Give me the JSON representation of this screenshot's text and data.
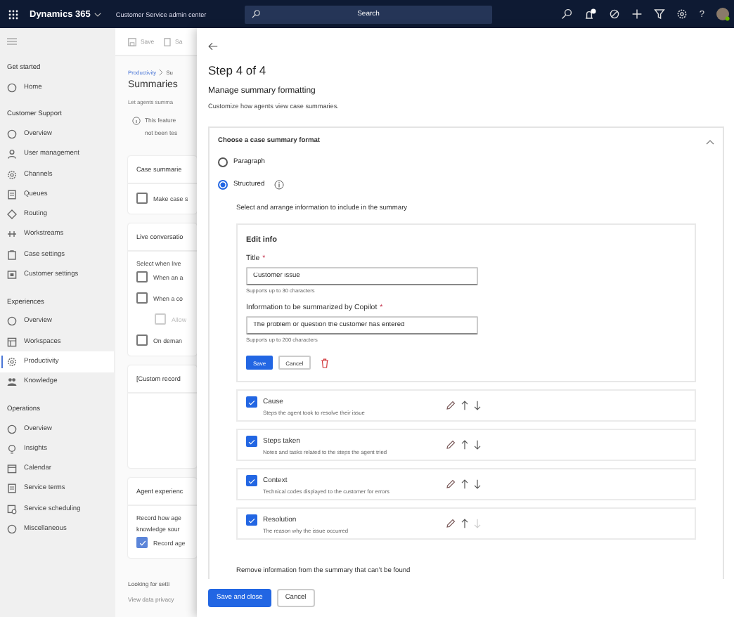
{
  "top_bar": {
    "app_name": "Dynamics 365",
    "area": "Customer Service admin center",
    "search": {
      "placeholder": "Search"
    },
    "help_label": "?"
  },
  "nav": {
    "groups": [
      {
        "label": "Get started",
        "items": [
          {
            "label": "Home",
            "selected": false
          }
        ]
      },
      {
        "label": "Customer Support",
        "items": [
          {
            "label": "Overview",
            "selected": false
          },
          {
            "label": "User management",
            "selected": false
          },
          {
            "label": "Channels",
            "selected": false
          },
          {
            "label": "Queues",
            "selected": false
          },
          {
            "label": "Routing",
            "selected": false
          },
          {
            "label": "Workstreams",
            "selected": false
          },
          {
            "label": "Case settings",
            "selected": false
          },
          {
            "label": "Customer settings",
            "selected": false
          }
        ]
      },
      {
        "label": "Experiences",
        "items": [
          {
            "label": "Overview",
            "selected": false
          },
          {
            "label": "Workspaces",
            "selected": false
          },
          {
            "label": "Productivity",
            "selected": true
          },
          {
            "label": "Knowledge",
            "selected": false
          }
        ]
      },
      {
        "label": "Operations",
        "items": [
          {
            "label": "Overview",
            "selected": false
          },
          {
            "label": "Insights",
            "selected": false
          },
          {
            "label": "Calendar",
            "selected": false
          },
          {
            "label": "Service terms",
            "selected": false
          },
          {
            "label": "Service scheduling",
            "selected": false
          },
          {
            "label": "Miscellaneous",
            "selected": false
          }
        ]
      }
    ]
  },
  "background_page": {
    "toolbar": [
      "Save",
      "Sa"
    ],
    "breadcrumb": [
      "Productivity",
      "Su"
    ],
    "title": "Summaries",
    "subtitle": "Let agents summa",
    "notice": [
      "This feature",
      "not been tes"
    ],
    "cards": [
      {
        "title": "Case summarie",
        "rows": [
          {
            "kind": "checkbox",
            "label": "Make case s",
            "checked": false,
            "disabled": false
          }
        ]
      },
      {
        "title": "Live conversatio",
        "rows": [
          {
            "kind": "text",
            "label": "Select when live"
          },
          {
            "kind": "checkbox",
            "label": "When an a",
            "checked": false,
            "disabled": false
          },
          {
            "kind": "checkbox",
            "label": "When a co",
            "checked": false,
            "disabled": false,
            "children": [
              {
                "kind": "checkbox",
                "label": "Allow",
                "checked": false,
                "disabled": true
              }
            ]
          },
          {
            "kind": "checkbox",
            "label": "On deman",
            "checked": false,
            "disabled": false
          }
        ]
      },
      {
        "title": "[Custom record"
      },
      {
        "title": "Agent experienc",
        "rows": [
          {
            "kind": "text",
            "label": "Record how age"
          },
          {
            "kind": "text",
            "label": "knowledge sour"
          },
          {
            "kind": "checkbox",
            "label": "Record age",
            "checked": true,
            "disabled": false
          }
        ]
      }
    ],
    "footer": [
      "Looking for setti",
      "View data privacy"
    ]
  },
  "panel": {
    "step": "Step 4 of 4",
    "heading": "Manage summary formatting",
    "description": "Customize how agents view case summaries.",
    "format": {
      "title": "Choose a case summary format",
      "expanded": true,
      "options": [
        {
          "label": "Paragraph",
          "selected": false,
          "info": false
        },
        {
          "label": "Structured",
          "selected": true,
          "info": true
        }
      ]
    },
    "instructions": "Select and arrange information to include in the summary",
    "edit_info": {
      "heading": "Edit info",
      "fields": [
        {
          "label": "Title",
          "required_mark": "*",
          "value": "Customer issue",
          "hint": "Supports up to 30 characters"
        },
        {
          "label": "Information to be summarized by Copilot",
          "required_mark": "*",
          "value": "The problem or question the customer has entered",
          "hint": "Supports up to 200 characters"
        }
      ],
      "buttons": [
        {
          "label": "Save",
          "primary": true
        },
        {
          "label": "Cancel",
          "primary": false
        }
      ]
    },
    "sections": [
      {
        "title": "Cause",
        "description": "Steps the agent took to resolve their issue",
        "checked": true,
        "can_move_up": true,
        "can_move_down": true
      },
      {
        "title": "Steps taken",
        "description": "Notes and tasks related to the steps the agent tried",
        "checked": true,
        "can_move_up": true,
        "can_move_down": true
      },
      {
        "title": "Context",
        "description": "Technical codes displayed to the customer for errors",
        "checked": true,
        "can_move_up": true,
        "can_move_down": true
      },
      {
        "title": "Resolution",
        "description": "The reason why the issue occurred",
        "checked": true,
        "can_move_up": true,
        "can_move_down": false
      }
    ],
    "remove_label": "Remove information from the summary that can’t be found",
    "footer_buttons": [
      {
        "label": "Save and close",
        "primary": true
      },
      {
        "label": "Cancel",
        "primary": false
      }
    ]
  }
}
